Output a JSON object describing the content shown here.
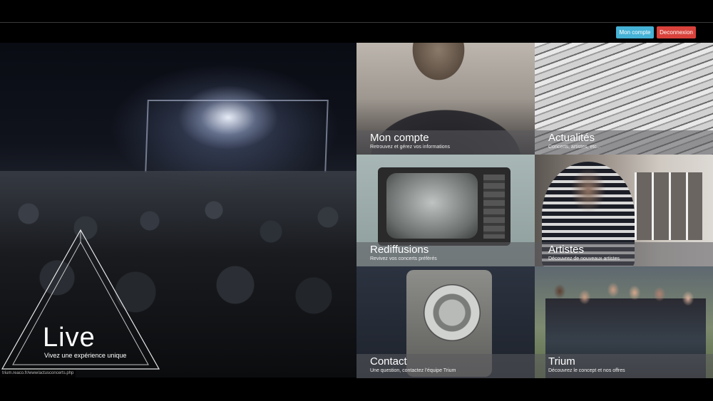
{
  "header": {
    "account_button": "Mon compte",
    "logout_button": "Deconnexion",
    "colors": {
      "account": "#45b2d6",
      "logout": "#d9423b"
    }
  },
  "hero": {
    "title": "Live",
    "subtitle": "Vivez une expérience unique"
  },
  "tiles": [
    {
      "title": "Mon compte",
      "subtitle": "Retrouvez et gérez vos informations"
    },
    {
      "title": "Actualités",
      "subtitle": "Concerts, artistes, etc..."
    },
    {
      "title": "Rediffusions",
      "subtitle": "Revivez vos concerts préférés"
    },
    {
      "title": "Artistes",
      "subtitle": "Découvrez de nouveaux artistes"
    },
    {
      "title": "Contact",
      "subtitle": "Une question, contactez l'équipe Trium"
    },
    {
      "title": "Trium",
      "subtitle": "Découvrez le concept et nos offres"
    }
  ],
  "status_bar": {
    "url": "trium.reaco.fr/www/actusconcerts.php"
  }
}
